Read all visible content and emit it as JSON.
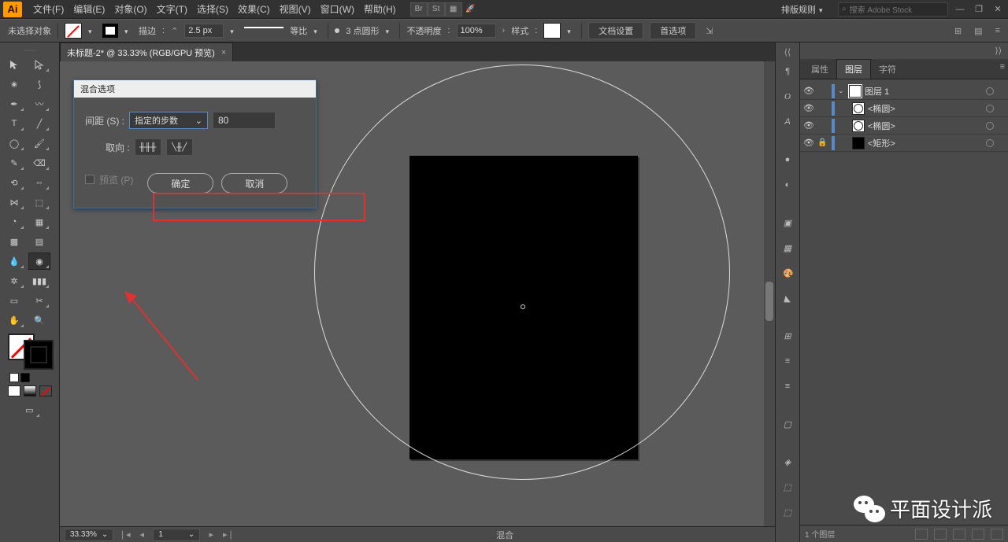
{
  "app": {
    "logo": "Ai"
  },
  "menu": {
    "items": [
      "文件(F)",
      "编辑(E)",
      "对象(O)",
      "文字(T)",
      "选择(S)",
      "效果(C)",
      "视图(V)",
      "窗口(W)",
      "帮助(H)"
    ],
    "workspace_switch": "排版规则",
    "search_placeholder": "搜索 Adobe Stock"
  },
  "optionsbar": {
    "selection_status": "未选择对象",
    "stroke_label": "描边",
    "stroke_weight": "2.5 px",
    "profile_label": "等比",
    "brush_label": "3 点圆形",
    "opacity_label": "不透明度",
    "opacity_value": "100%",
    "style_label": "样式",
    "docsetup_btn": "文档设置",
    "prefs_btn": "首选项"
  },
  "document": {
    "tab_title": "未标题-2* @ 33.33% (RGB/GPU 预览)"
  },
  "dialog": {
    "title": "混合选项",
    "spacing_label": "间距 (S) :",
    "spacing_mode": "指定的步数",
    "spacing_value": "80",
    "orient_label": "取向 :",
    "preview_label": "预览 (P)",
    "ok": "确定",
    "cancel": "取消"
  },
  "statusbar": {
    "zoom": "33.33%",
    "artboard_nav": "1",
    "tool_hint": "混合"
  },
  "dock_icons": [
    "¶",
    "O",
    "A",
    "",
    "●",
    "◐",
    "",
    "▣",
    "▦",
    "🎨",
    "◣",
    "",
    "⊞",
    "≡",
    "≡",
    "",
    "▢",
    "",
    "◈",
    "⬚",
    "⬚"
  ],
  "panels": {
    "tabs": [
      "属性",
      "图层",
      "字符"
    ],
    "active_tab": 1,
    "layers": [
      {
        "name": "图层 1",
        "thumb": "sel",
        "expandable": true,
        "indent": 0
      },
      {
        "name": "<椭圆>",
        "thumb": "circ",
        "indent": 1
      },
      {
        "name": "<椭圆>",
        "thumb": "circ",
        "indent": 1
      },
      {
        "name": "<矩形>",
        "thumb": "black",
        "indent": 1,
        "locked": true
      }
    ],
    "footer_count": "1 个图层"
  },
  "watermark": "平面设计派"
}
